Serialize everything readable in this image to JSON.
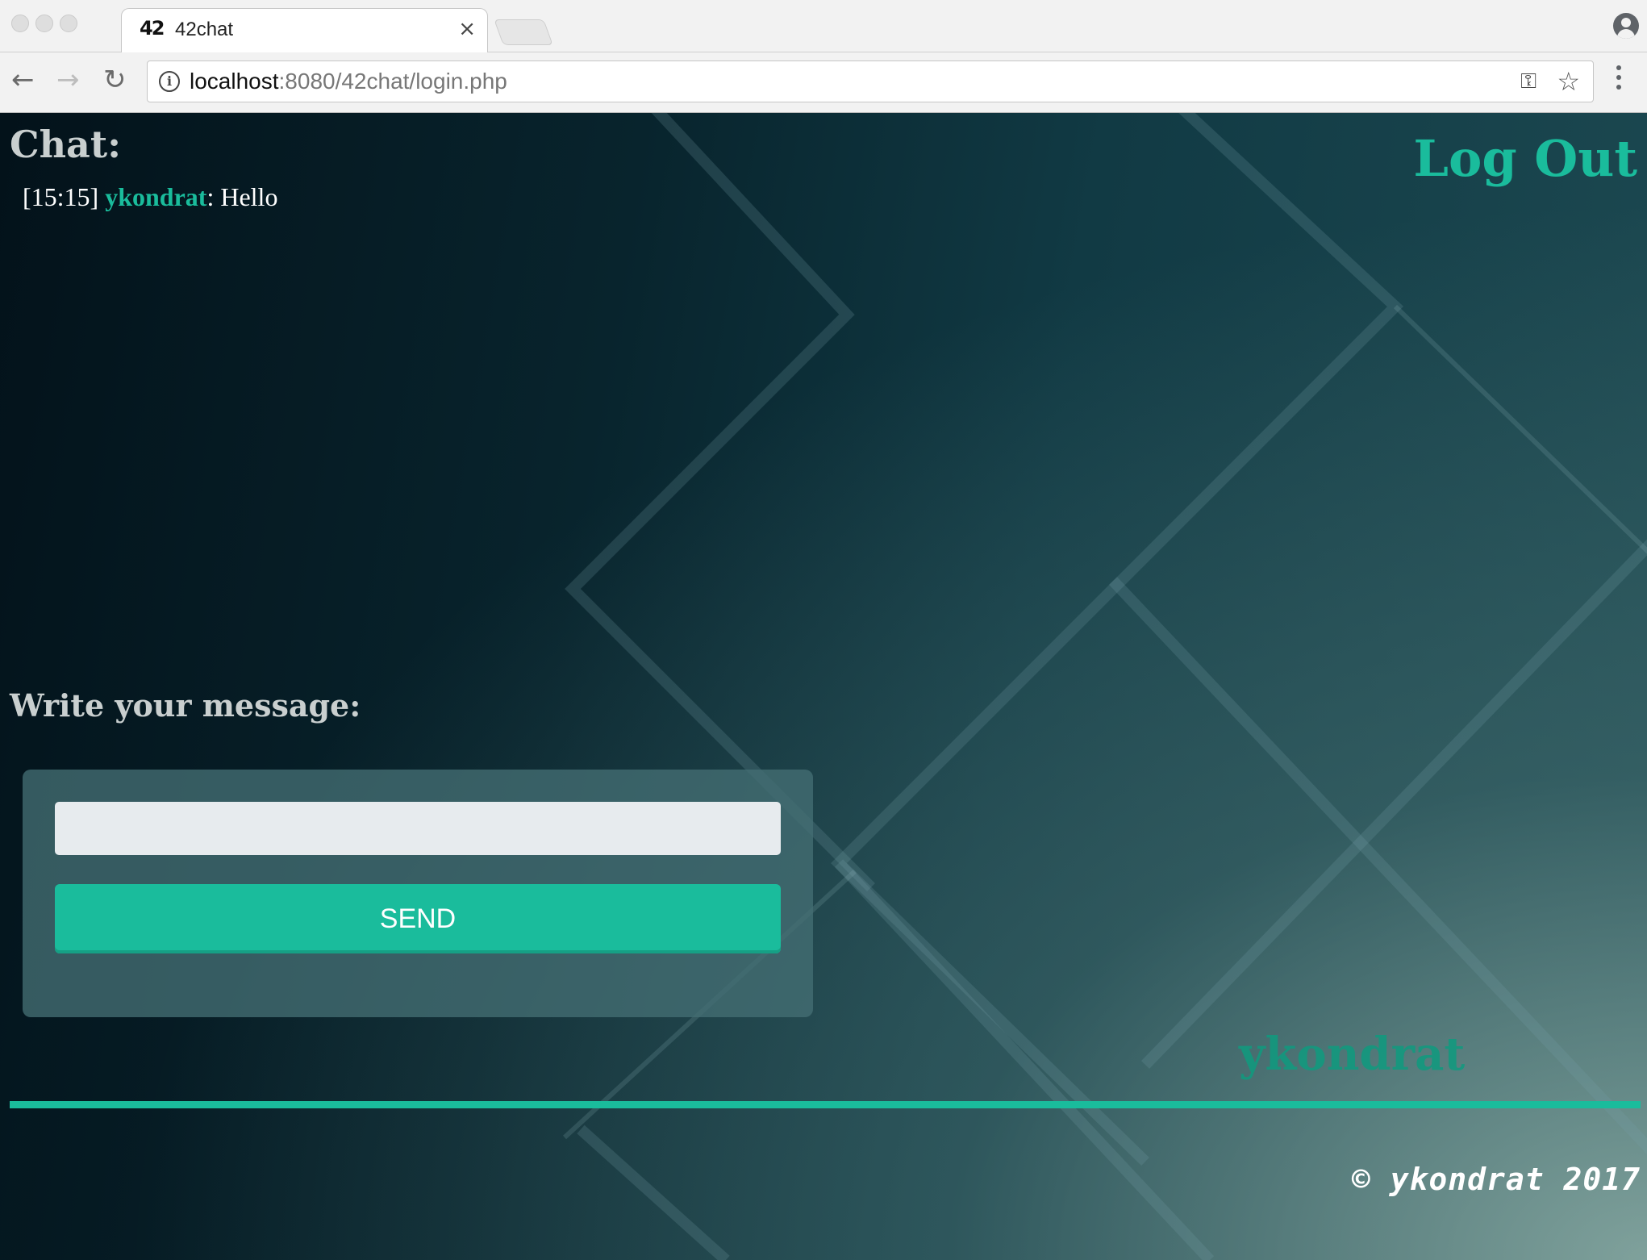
{
  "browser": {
    "tab_logo": "42",
    "tab_title": "42chat",
    "tab_close": "×",
    "url_host": "localhost",
    "url_rest": ":8080/42chat/login.php",
    "icons": {
      "back": "arrow-left-icon",
      "forward": "arrow-right-icon",
      "reload": "reload-icon",
      "info": "info-icon",
      "key": "key-icon",
      "star": "star-icon",
      "menu": "kebab-menu-icon",
      "profile": "profile-icon"
    }
  },
  "page": {
    "chat_heading": "Chat:",
    "logout_label": "Log Out",
    "messages": [
      {
        "time": "[15:15]",
        "user": "ykondrat",
        "text": ": Hello"
      }
    ],
    "write_label": "Write your message:",
    "input_value": "",
    "send_label": "SEND",
    "username": "ykondrat",
    "copyright": "© ykondrat 2017"
  },
  "colors": {
    "accent": "#1abc9c",
    "heading": "#c9cfcf",
    "panel": "#446e73",
    "input_bg": "#e7ebee"
  }
}
